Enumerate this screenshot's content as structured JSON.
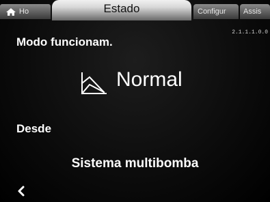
{
  "tabs": {
    "home": {
      "label": "Ho",
      "icon": "house-icon"
    },
    "active": {
      "label": "Estado"
    },
    "config": {
      "label": "Configur"
    },
    "assist": {
      "label": "Assis"
    }
  },
  "version": "2.1.1.1.0.0",
  "operation": {
    "title": "Modo funcionam.",
    "value": "Normal",
    "icon": "control-curve-icon"
  },
  "source": {
    "title": "Desde",
    "value": "Sistema multibomba"
  },
  "navigation": {
    "back_icon": "chevron-left-icon"
  }
}
